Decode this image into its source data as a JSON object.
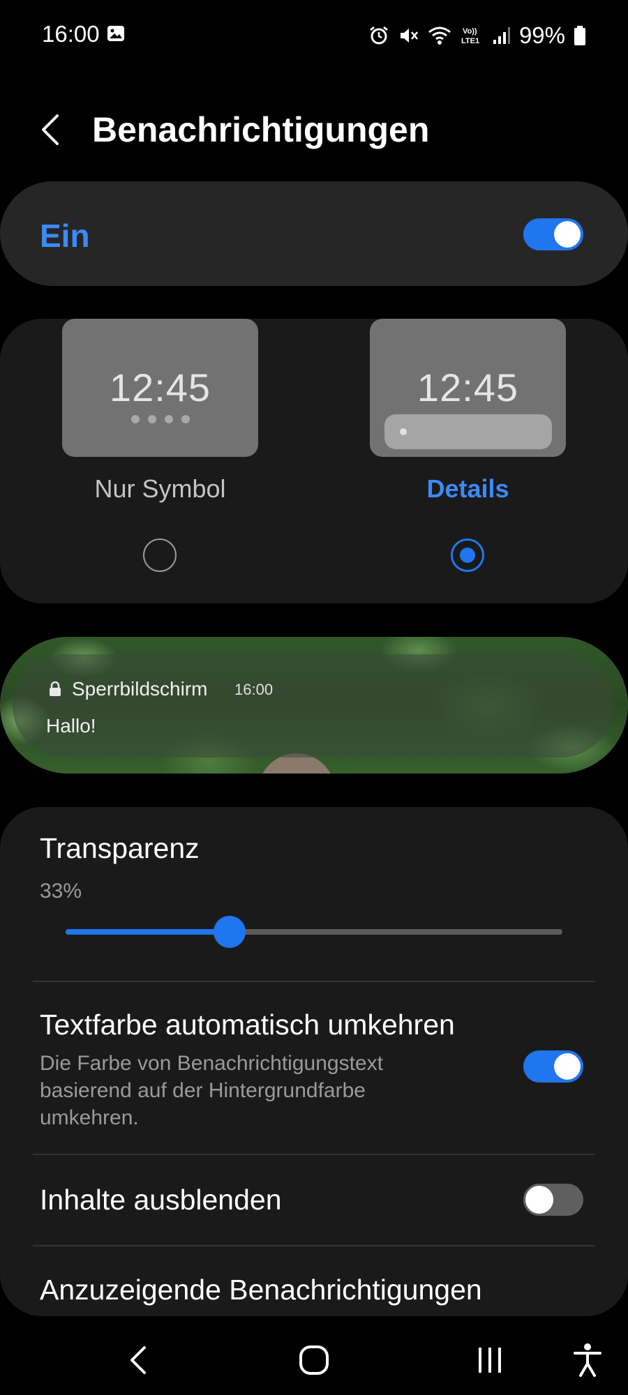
{
  "status_bar": {
    "time": "16:00",
    "battery": "99%",
    "icons": [
      "image-icon",
      "alarm-icon",
      "mute-icon",
      "wifi-icon",
      "volte-icon",
      "signal-icon",
      "battery-icon"
    ]
  },
  "header": {
    "title": "Benachrichtigungen",
    "back_icon": "chevron-left-icon"
  },
  "master_switch": {
    "label": "Ein",
    "state": true,
    "accent": "#3d8af7"
  },
  "style_options": {
    "items": [
      {
        "label": "Nur Symbol",
        "clock": "12:45",
        "selected": false
      },
      {
        "label": "Details",
        "clock": "12:45",
        "selected": true
      }
    ]
  },
  "preview": {
    "app": "Sperrbildschirm",
    "time": "16:00",
    "message": "Hallo!"
  },
  "settings": {
    "transparency": {
      "title": "Transparenz",
      "value": "33%",
      "level": 0.33
    },
    "invert_text": {
      "title": "Textfarbe automatisch umkehren",
      "subtitle_lines": [
        "Die Farbe von Benachrichtigungstext",
        "basierend auf der Hintergrundfarbe",
        "umkehren."
      ],
      "state": true
    },
    "hide_content": {
      "title": "Inhalte ausblenden",
      "state": false
    },
    "notifications_to_show": {
      "title": "Anzuzeigende Benachrichtigungen"
    }
  },
  "nav_bar": {
    "icons": [
      "back-icon",
      "home-icon",
      "recents-icon",
      "accessibility-icon"
    ]
  }
}
